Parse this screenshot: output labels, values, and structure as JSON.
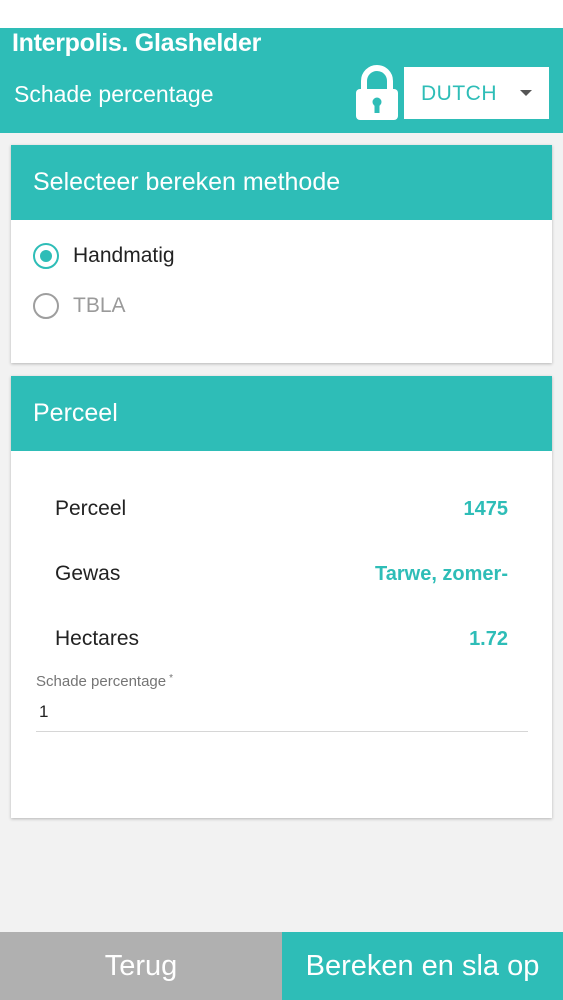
{
  "header": {
    "brand": "Interpolis. Glashelder",
    "subtitle": "Schade percentage",
    "language": "DUTCH",
    "lock_icon": "lock-icon"
  },
  "method_card": {
    "title": "Selecteer bereken methode",
    "options": [
      {
        "label": "Handmatig",
        "selected": true
      },
      {
        "label": "TBLA",
        "selected": false
      }
    ]
  },
  "perceel_card": {
    "title": "Perceel",
    "rows": [
      {
        "key": "Perceel",
        "value": "1475"
      },
      {
        "key": "Gewas",
        "value": "Tarwe, zomer-"
      },
      {
        "key": "Hectares",
        "value": "1.72"
      }
    ],
    "field": {
      "label": "Schade percentage",
      "required_mark": "*",
      "value": "1"
    }
  },
  "footer": {
    "back_label": "Terug",
    "save_label": "Bereken en sla op"
  },
  "colors": {
    "accent": "#2ebdb7",
    "back_button": "#b0b0b0"
  }
}
